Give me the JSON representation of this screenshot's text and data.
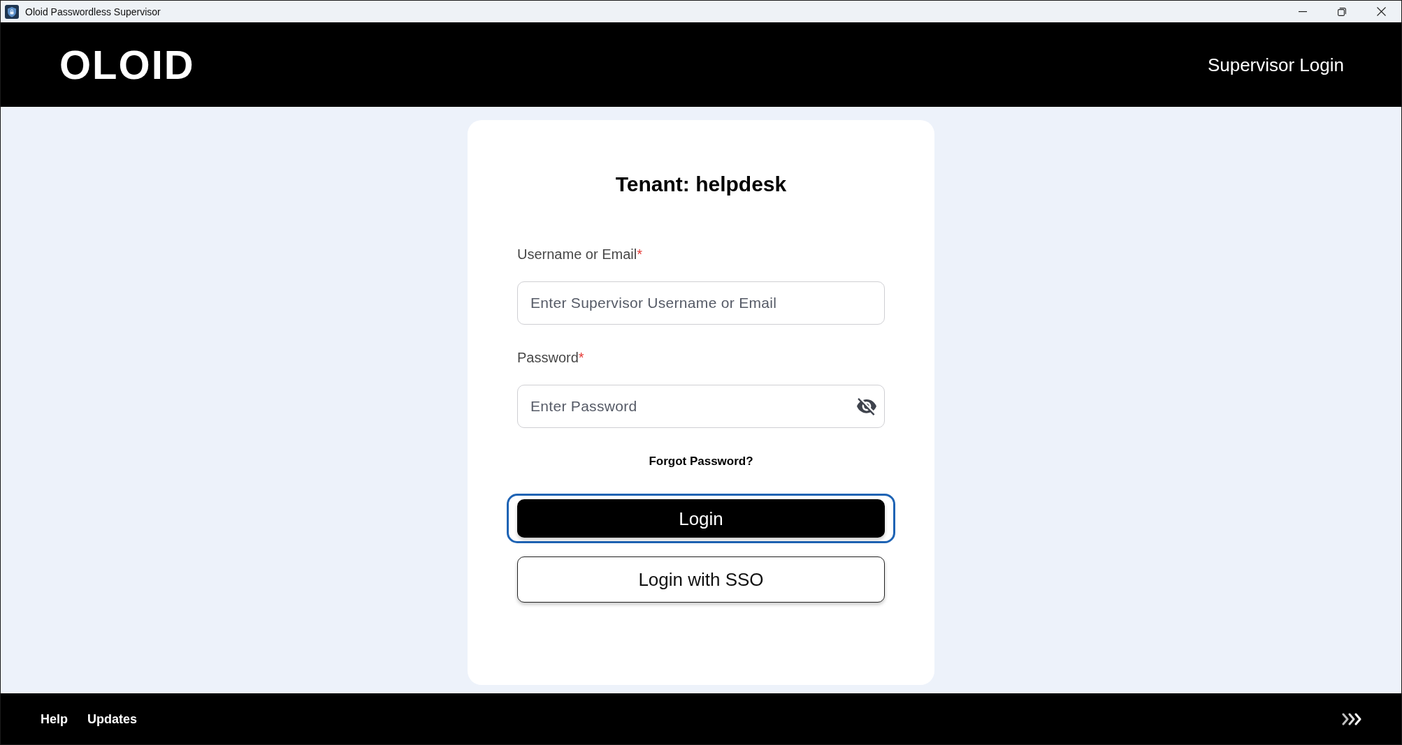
{
  "window": {
    "title": "Oloid Passwordless Supervisor"
  },
  "header": {
    "logo": "OLOID",
    "title": "Supervisor Login"
  },
  "login_card": {
    "title": "Tenant: helpdesk",
    "fields": [
      {
        "kind": "text",
        "label": "Username or Email",
        "required_mark": "*",
        "placeholder": "Enter Supervisor Username or Email"
      },
      {
        "kind": "password",
        "label": "Password",
        "required_mark": "*",
        "placeholder": "Enter Password",
        "masked": true
      }
    ],
    "forgot_link": "Forgot Password?",
    "buttons": [
      {
        "kind": "primary",
        "label": "Login",
        "focused": true
      },
      {
        "kind": "secondary",
        "label": "Login with SSO",
        "focused": false
      }
    ]
  },
  "footer": {
    "links": [
      "Help",
      "Updates"
    ]
  }
}
